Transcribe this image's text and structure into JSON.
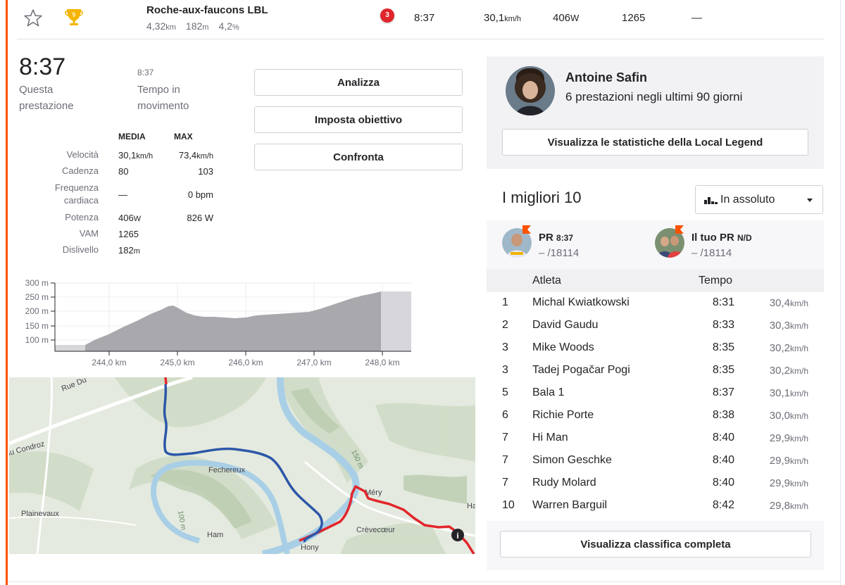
{
  "segment": {
    "name": "Roche-aux-faucons LBL",
    "distance": "4,32",
    "distance_unit": "km",
    "elevation": "182",
    "elevation_unit": "m",
    "grade": "4,2",
    "grade_unit": "%",
    "trophy_rank": "5",
    "badge_rank": "3"
  },
  "header_row": {
    "time": "8:37",
    "speed": "30,1",
    "speed_unit": "km/h",
    "power": "406",
    "power_unit": "W",
    "vam": "1265",
    "hr": "—"
  },
  "effort": {
    "time": "8:37",
    "time_label": "Questa prestazione",
    "moving_time": "8:37",
    "moving_label": "Tempo in movimento"
  },
  "stats": {
    "col_avg": "MEDIA",
    "col_max": "MAX",
    "rows": [
      {
        "label": "Velocità",
        "avg": "30,1",
        "avg_unit": "km/h",
        "max": "73,4",
        "max_unit": "km/h"
      },
      {
        "label": "Cadenza",
        "avg": "80",
        "avg_unit": "",
        "max": "103",
        "max_unit": ""
      },
      {
        "label": "Frequenza cardiaca",
        "avg": "—",
        "avg_unit": "",
        "max": "0 bpm",
        "max_unit": ""
      },
      {
        "label": "Potenza",
        "avg": "406",
        "avg_unit": "W",
        "max": "826 W",
        "max_unit": ""
      },
      {
        "label": "VAM",
        "avg": "1265",
        "avg_unit": "",
        "max": "",
        "max_unit": ""
      },
      {
        "label": "Dislivello",
        "avg": "182",
        "avg_unit": "m",
        "max": "",
        "max_unit": ""
      }
    ]
  },
  "actions": {
    "analyze": "Analizza",
    "set_goal": "Imposta obiettivo",
    "compare": "Confronta"
  },
  "elevation_chart": {
    "y_ticks": [
      "300 m",
      "250 m",
      "200 m",
      "150 m",
      "100 m"
    ],
    "x_ticks": [
      "244,0 km",
      "245,0 km",
      "246,0 km",
      "247,0 km",
      "248,0 km"
    ]
  },
  "map": {
    "labels": [
      "Rue Du",
      "du Condroz",
      "Fechereux",
      "Plainevaux",
      "Ham",
      "Hony",
      "Méry",
      "Crèvecœur",
      "150 m",
      "100 m",
      "Ha"
    ],
    "info_icon": "i"
  },
  "local_legend": {
    "name": "Antoine Safin",
    "subtitle": "6 prestazioni negli ultimi 90 giorni",
    "stats_button": "Visualizza le statistiche della Local Legend"
  },
  "leaderboard": {
    "title": "I migliori 10",
    "filter_value": "In assoluto",
    "pr": {
      "label": "PR",
      "time": "8:37",
      "rank": "– /18114"
    },
    "your_pr": {
      "label": "Il tuo PR",
      "time": "N/D",
      "rank": "– /18114"
    },
    "col_athlete": "Atleta",
    "col_time": "Tempo",
    "rows": [
      {
        "rank": "1",
        "name": "Michal Kwiatkowski",
        "time": "8:31",
        "speed": "30,4"
      },
      {
        "rank": "2",
        "name": "David Gaudu",
        "time": "8:33",
        "speed": "30,3"
      },
      {
        "rank": "3",
        "name": "Mike Woods",
        "time": "8:35",
        "speed": "30,2"
      },
      {
        "rank": "3",
        "name": "Tadej Pogačar Pogi",
        "time": "8:35",
        "speed": "30,2"
      },
      {
        "rank": "5",
        "name": "Bala 1",
        "time": "8:37",
        "speed": "30,1"
      },
      {
        "rank": "6",
        "name": "Richie Porte",
        "time": "8:38",
        "speed": "30,0"
      },
      {
        "rank": "7",
        "name": "Hi Man",
        "time": "8:40",
        "speed": "29,9"
      },
      {
        "rank": "7",
        "name": "Simon Geschke",
        "time": "8:40",
        "speed": "29,9"
      },
      {
        "rank": "7",
        "name": "Rudy Molard",
        "time": "8:40",
        "speed": "29,9"
      },
      {
        "rank": "10",
        "name": "Warren Barguil",
        "time": "8:42",
        "speed": "29,8"
      }
    ],
    "speed_unit": "km/h",
    "full_button": "Visualizza classifica completa"
  }
}
